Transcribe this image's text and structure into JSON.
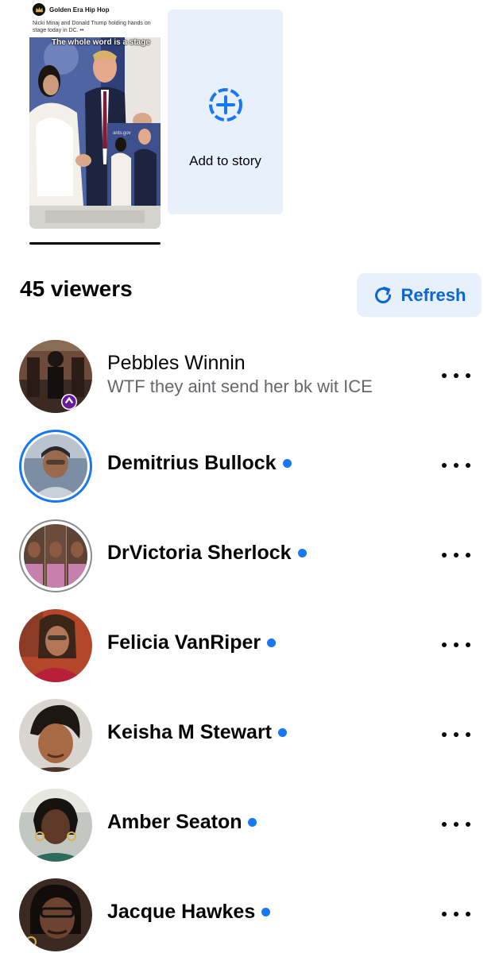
{
  "story": {
    "source_name": "Golden Era Hip Hop",
    "caption": "Nicki Minaj and Donald Trump holding hands on stage today in DC. ••",
    "overlay_text": "The whole word is a stage",
    "watermark": "ants.gov"
  },
  "add_story": {
    "label": "Add to story"
  },
  "viewers": {
    "count_label": "45 viewers",
    "refresh_label": "Refresh",
    "items": [
      {
        "name": "Pebbles Winnin",
        "reply": "WTF they aint send her bk wit ICE",
        "online": false
      },
      {
        "name": "Demitrius Bullock",
        "online": true
      },
      {
        "name": "DrVictoria Sherlock",
        "online": true
      },
      {
        "name": "Felicia VanRiper",
        "online": true
      },
      {
        "name": "Keisha M Stewart",
        "online": true
      },
      {
        "name": "Amber Seaton",
        "online": true
      },
      {
        "name": "Jacque Hawkes",
        "online": true
      }
    ]
  },
  "colors": {
    "accent": "#1877f2",
    "refresh_text": "#0a66d8",
    "tint_bg": "#e7f0fb",
    "secondary_text": "#65676b"
  }
}
